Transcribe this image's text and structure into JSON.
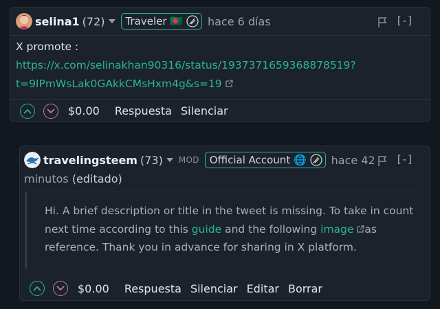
{
  "comment1": {
    "username": "selina1",
    "reputation": "(72)",
    "badge_label": "Traveler 🇧🇩",
    "time": "hace 6 días",
    "collapse_label": "[-]",
    "body_line1": "X promote :",
    "link_line1": "https://x.com/selinakhan90316/status/1937371659368878519?",
    "link_line2": "t=9IPmWsLak0GAkkCMsHxm4g&s=19",
    "payout": "$0.00",
    "actions": {
      "reply": "Respuesta",
      "mute": "Silenciar"
    }
  },
  "comment2": {
    "username": "travelingsteem",
    "reputation": "(73)",
    "mod_label": "MOD",
    "badge_label": "Official Account 🌐",
    "time": "hace 42",
    "time_cont": "minutos",
    "edited": "(editado)",
    "collapse_label": "[-]",
    "quote_text_1": "Hi. A brief description or title in the tweet is missing. To take in count next time according to this ",
    "quote_link_guide": "guide",
    "quote_text_2": " and the following ",
    "quote_link_image": "image",
    "quote_text_3": "as reference. Thank you in advance for sharing in X platform.",
    "payout": "$0.00",
    "actions": {
      "reply": "Respuesta",
      "mute": "Silenciar",
      "edit": "Editar",
      "delete": "Borrar"
    }
  },
  "colors": {
    "accent": "#2bb594",
    "downvote": "#c97a90",
    "background": "#121820",
    "card": "#1b222c"
  }
}
